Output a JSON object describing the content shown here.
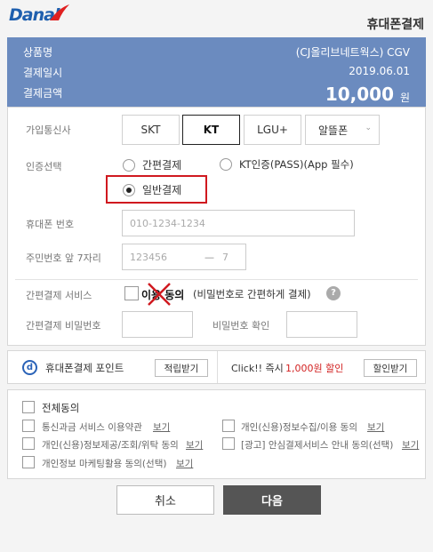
{
  "brand": {
    "logo": "Danal"
  },
  "header": {
    "title": "휴대폰결제"
  },
  "summary": {
    "product_label": "상품명",
    "product_value": "(CJ올리브네트웍스) CGV",
    "date_label": "결제일시",
    "date_value": "2019.06.01",
    "amount_label": "결제금액",
    "amount_value": "10,000",
    "amount_unit": "원"
  },
  "carrier": {
    "label": "가입통신사",
    "options": [
      "SKT",
      "KT",
      "LGU+",
      "알뜰폰"
    ],
    "selected": "KT"
  },
  "auth": {
    "label": "인증선택",
    "options": [
      "간편결제",
      "KT인증(PASS)(App 필수)",
      "일반결제"
    ],
    "selected": "일반결제"
  },
  "phone": {
    "label": "휴대폰 번호",
    "placeholder": "010-1234-1234"
  },
  "resident": {
    "label": "주민번호 앞 7자리",
    "front_placeholder": "123456",
    "dash": "—",
    "back_placeholder": "7"
  },
  "easy_service": {
    "label": "간편결제 서비스",
    "agree_text": "이용 동의",
    "desc": "(비밀번호로 간편하게 결제)",
    "help": "?"
  },
  "easy_pw": {
    "label": "간편결제 비밀번호",
    "confirm_label": "비밀번호 확인"
  },
  "points": {
    "label": "휴대폰결제 포인트",
    "button": "적립받기",
    "promo_prefix": "Click!! 즉시",
    "promo_amount": "1,000원 할인",
    "promo_button": "할인받기",
    "accent": "#d22222"
  },
  "terms": {
    "all": "전체동의",
    "items": [
      {
        "text": "통신과금 서비스 이용약관",
        "link": "보기"
      },
      {
        "text": "개인(신용)정보수집/이용 동의",
        "link": "보기"
      },
      {
        "text": "개인(신용)정보제공/조회/위탁 동의",
        "link": "보기"
      },
      {
        "text": "[광고] 안심결제서비스 안내 동의(선택)",
        "link": "보기"
      },
      {
        "text": "개인정보 마케팅활용 동의(선택)",
        "link": "보기"
      }
    ]
  },
  "actions": {
    "cancel": "취소",
    "next": "다음"
  }
}
